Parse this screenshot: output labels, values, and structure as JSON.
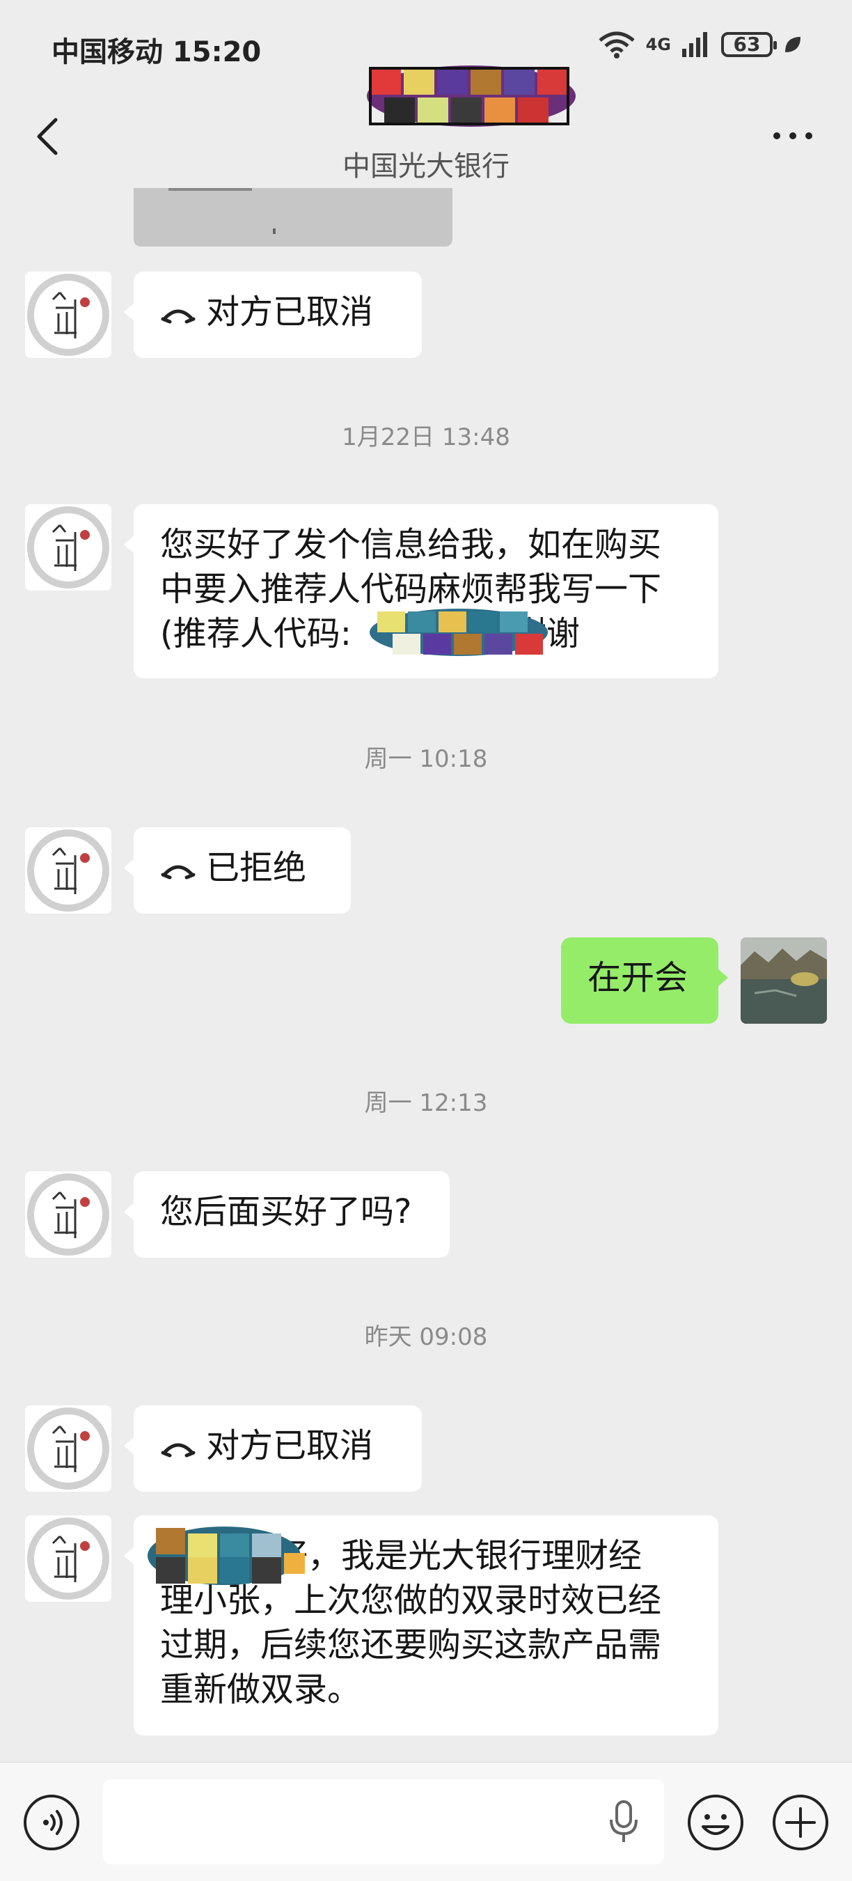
{
  "status_bar": {
    "carrier_time": "中国移动 15:20",
    "network": "4G",
    "battery": "63"
  },
  "header": {
    "subtitle": "中国光大银行",
    "icons": [
      "back-arrow-icon",
      "more-dots-icon"
    ]
  },
  "messages": {
    "m1": {
      "text": "对方已取消"
    },
    "t1": "1月22日 13:48",
    "m2": {
      "line1": "您买好了发个信息给我，如在购买",
      "line2": "中要入推荐人代码麻烦帮我写一下",
      "line3_start": "(推荐人代码:",
      "line3_end": "谢谢"
    },
    "t2": "周一 10:18",
    "m3": {
      "text": "已拒绝"
    },
    "m4": {
      "text": "在开会"
    },
    "t3": "周一 12:13",
    "m5": {
      "text": "您后面买好了吗?"
    },
    "t4": "昨天 09:08",
    "m6": {
      "text": "对方已取消"
    },
    "m7": {
      "line1_end": "好，我是光大银行理财经",
      "line2": "理小张，上次您做的双录时效已经",
      "line3": "过期，后续您还要购买这款产品需",
      "line4": "重新做双录。"
    }
  },
  "colors": {
    "background": "#ededed",
    "bubble_in": "#ffffff",
    "bubble_out": "#95ec69",
    "timestamp": "#8a8a8a"
  }
}
